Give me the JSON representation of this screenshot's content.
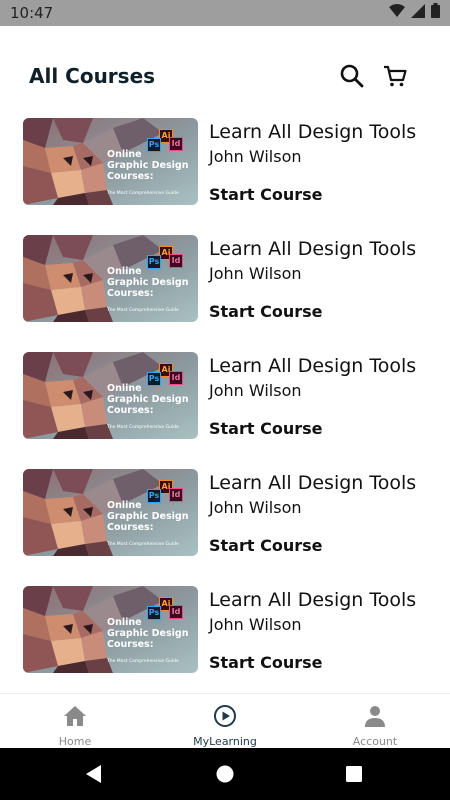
{
  "status_bar": {
    "time": "10:47",
    "icons": [
      "wifi-icon",
      "signal-icon",
      "battery-icon"
    ]
  },
  "header": {
    "title": "All Courses",
    "icons": [
      "search-icon",
      "cart-icon"
    ]
  },
  "thumbnail": {
    "lines": [
      "Online",
      "Graphic Design",
      "Courses:"
    ],
    "tagline": "The Most Comprehensive Guide",
    "badges": [
      "Ai",
      "Ps",
      "Id"
    ]
  },
  "courses": [
    {
      "title": "Learn All Design Tools",
      "author": "John Wilson",
      "action": "Start Course"
    },
    {
      "title": "Learn All Design Tools",
      "author": "John Wilson",
      "action": "Start Course"
    },
    {
      "title": "Learn All Design Tools",
      "author": "John Wilson",
      "action": "Start Course"
    },
    {
      "title": "Learn All Design Tools",
      "author": "John Wilson",
      "action": "Start Course"
    },
    {
      "title": "Learn All Design Tools",
      "author": "John Wilson",
      "action": "Start Course"
    }
  ],
  "bottom_nav": {
    "items": [
      {
        "label": "Home",
        "icon": "home-icon",
        "active": false
      },
      {
        "label": "MyLearning",
        "icon": "play-circle-icon",
        "active": true
      },
      {
        "label": "Account",
        "icon": "person-icon",
        "active": false
      }
    ]
  },
  "colors": {
    "status_bar": "#9e9e9e",
    "title": "#10202a",
    "active_nav": "#1f3a4a",
    "inactive_nav": "#8a8a8a",
    "system_nav": "#000000"
  }
}
